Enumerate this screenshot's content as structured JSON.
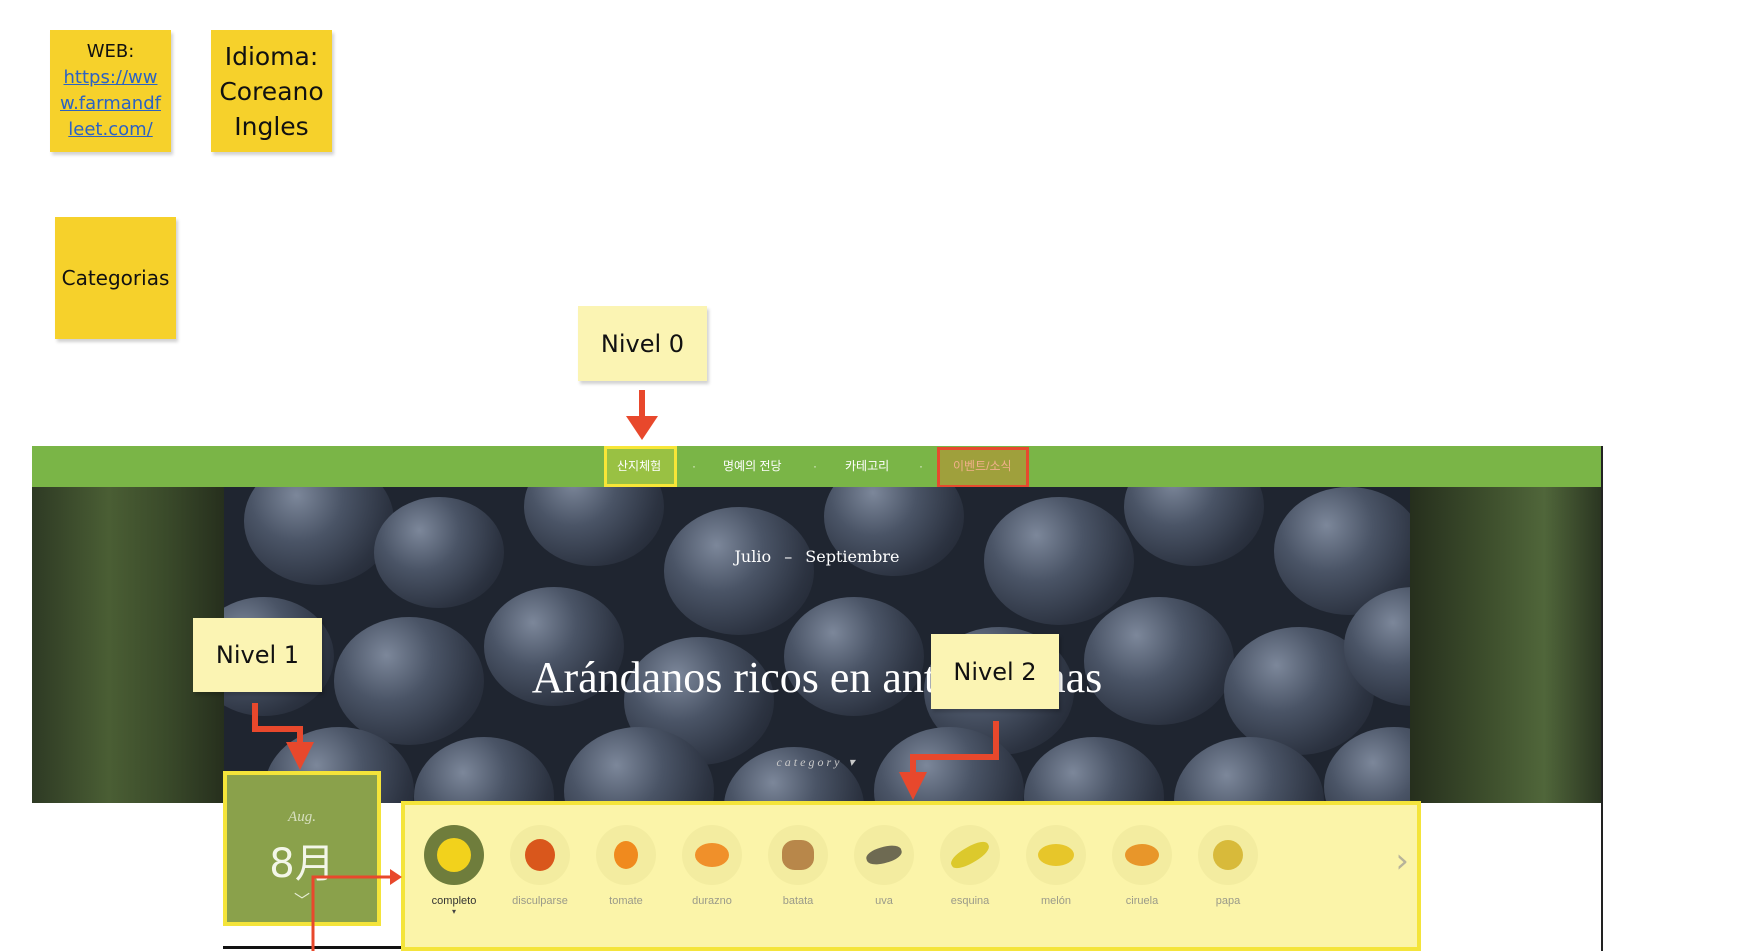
{
  "notes": {
    "web": {
      "label": "WEB:",
      "url": "https://www.farmandfleet.com/"
    },
    "language": {
      "line1": "Idioma:",
      "line2": "Coreano",
      "line3": "Ingles"
    },
    "categories": "Categorias",
    "level0": "Nivel 0",
    "level1": "Nivel 1",
    "level2": "Nivel 2"
  },
  "nav": {
    "items": [
      "산지체험",
      "명예의 전당",
      "카테고리",
      "이벤트/소식"
    ],
    "separator": "·"
  },
  "hero": {
    "date_from": "Julio",
    "date_dash": "–",
    "date_to": "Septiembre",
    "title": "Arándanos ricos en antocianinas",
    "category_label": "category ▾"
  },
  "month": {
    "en": "Aug.",
    "num": "8月",
    "chevron": "﹀"
  },
  "categories": {
    "items": [
      {
        "label": "completo",
        "color": "#f2d21c",
        "active": true
      },
      {
        "label": "disculparse",
        "color": "#d9571c",
        "active": false
      },
      {
        "label": "tomate",
        "color": "#f08a1e",
        "active": false
      },
      {
        "label": "durazno",
        "color": "#f0902a",
        "active": false
      },
      {
        "label": "batata",
        "color": "#b8874a",
        "active": false
      },
      {
        "label": "uva",
        "color": "#6e6a52",
        "active": false
      },
      {
        "label": "esquina",
        "color": "#dcc92c",
        "active": false
      },
      {
        "label": "melón",
        "color": "#e7c62a",
        "active": false
      },
      {
        "label": "ciruela",
        "color": "#e8962a",
        "active": false
      },
      {
        "label": "papa",
        "color": "#d8ba3a",
        "active": false
      }
    ],
    "next_icon": "chevron-right-icon",
    "next_glyph": "›",
    "active_caret": "▾"
  },
  "colors": {
    "nav_green": "#7ab547",
    "highlight_yellow": "#f7e637",
    "highlight_red": "#e64a2e",
    "arrow_red": "#e8482c"
  }
}
